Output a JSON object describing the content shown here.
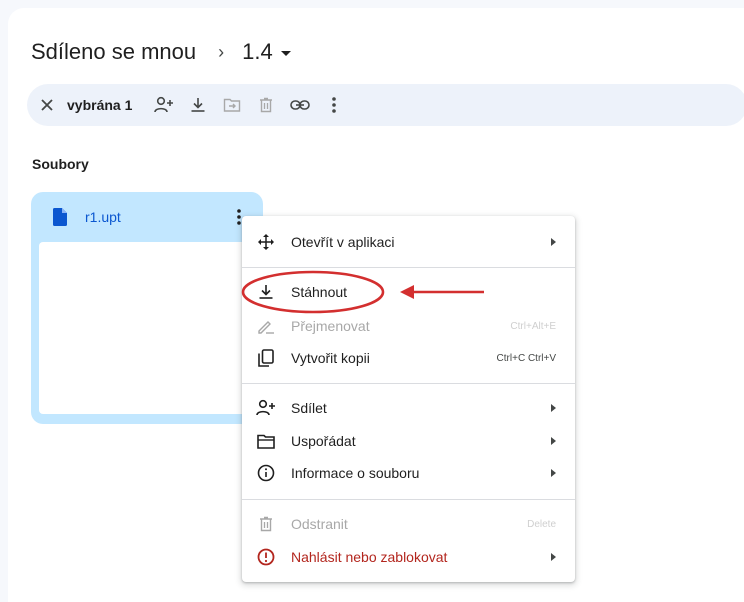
{
  "breadcrumb": {
    "root": "Sdíleno se mnou",
    "separator": "›",
    "current": "1.4"
  },
  "selection_bar": {
    "count_label": "vybrána 1",
    "actions": [
      "close-icon",
      "share-icon",
      "download-icon",
      "move-icon",
      "trash-icon",
      "link-icon",
      "more-vert-icon"
    ]
  },
  "section": {
    "label": "Soubory"
  },
  "file_card": {
    "name": "r1.upt",
    "icon": "document-icon"
  },
  "context_menu": {
    "items": [
      {
        "label": "Otevřít v aplikaci",
        "icon": "open-with-icon",
        "submenu": true
      },
      {
        "label": "Stáhnout",
        "icon": "download-icon"
      },
      {
        "label": "Přejmenovat",
        "icon": "rename-icon",
        "shortcut": "Ctrl+Alt+E",
        "disabled": true
      },
      {
        "label": "Vytvořit kopii",
        "icon": "copy-icon",
        "shortcut": "Ctrl+C Ctrl+V"
      },
      {
        "label": "Sdílet",
        "icon": "share-icon",
        "submenu": true
      },
      {
        "label": "Uspořádat",
        "icon": "folder-icon",
        "submenu": true
      },
      {
        "label": "Informace o souboru",
        "icon": "info-icon",
        "submenu": true
      },
      {
        "label": "Odstranit",
        "icon": "trash-icon",
        "shortcut": "Delete",
        "disabled": true
      },
      {
        "label": "Nahlásit nebo zablokovat",
        "icon": "report-icon",
        "submenu": true
      }
    ]
  },
  "annotation": {
    "color": "#d32f2f"
  }
}
